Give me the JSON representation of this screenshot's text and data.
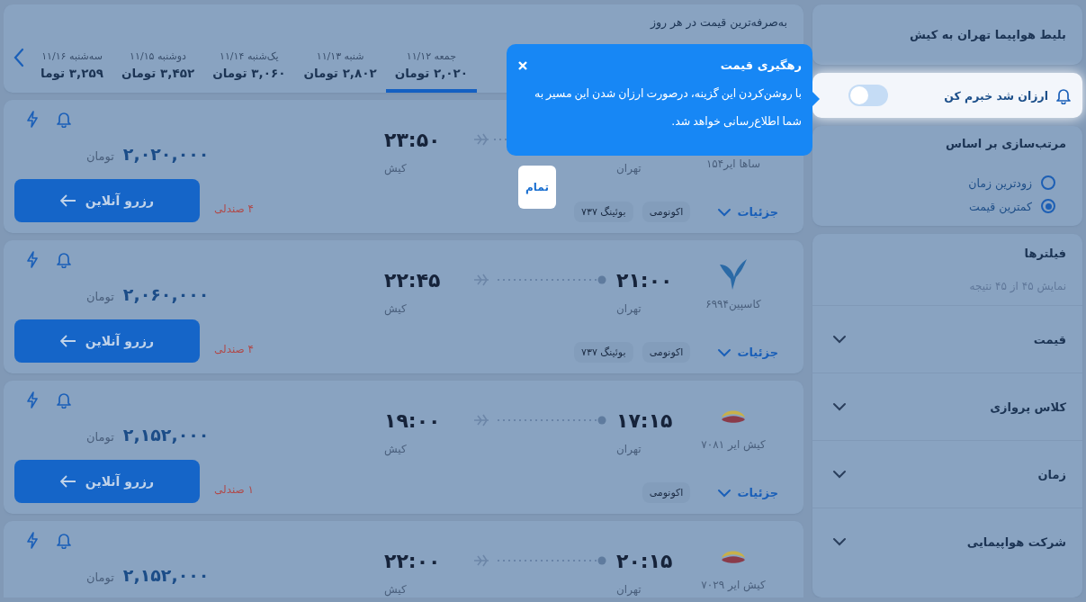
{
  "sidebar": {
    "route_title": "بلیط هواپیما تهران به کیش",
    "price_alert": {
      "label": "ارزان شد خبرم کن",
      "on": false
    },
    "sort": {
      "title": "مرتب‌سازی بر اساس",
      "options": [
        {
          "label": "زودترین زمان",
          "selected": false
        },
        {
          "label": "کمترین قیمت",
          "selected": true
        }
      ]
    },
    "filters": {
      "title": "فیلترها",
      "result_count": "نمایش ۴۵ از ۴۵ نتیجه",
      "groups": [
        {
          "label": "قیمت",
          "expanded": false
        },
        {
          "label": "کلاس پروازی",
          "expanded": false
        },
        {
          "label": "زمان",
          "expanded": false
        },
        {
          "label": "شرکت هواپیمایی",
          "expanded": false
        }
      ]
    }
  },
  "date_bar": {
    "title": "به‌صرفه‌ترین قیمت در هر روز",
    "days": [
      {
        "date": "جمعه ۱۱/۱۲",
        "price": "۲,۰۲۰ تومان",
        "selected": true
      },
      {
        "date": "شنبه ۱۱/۱۳",
        "price": "۲,۸۰۲ تومان",
        "selected": false
      },
      {
        "date": "یک‌شنبه ۱۱/۱۴",
        "price": "۳,۰۶۰ تومان",
        "selected": false
      },
      {
        "date": "دوشنبه ۱۱/۱۵",
        "price": "۳,۴۵۲ تومان",
        "selected": false
      },
      {
        "date": "سه‌شنبه ۱۱/۱۶",
        "price": "۳,۲۵۹ توما",
        "selected": false
      }
    ]
  },
  "flights": [
    {
      "airline": "ساها ایر۱۵۴",
      "origin": "تهران",
      "arrival_time": "۲۳:۵۰",
      "destination": "کیش",
      "price": "۲,۰۲۰,۰۰۰",
      "currency": "تومان",
      "book": "رزرو آنلاین",
      "seats": "۴ صندلی",
      "details": "جزئیات",
      "tags": [
        "اکونومی",
        "بوئینگ ۷۳۷"
      ]
    },
    {
      "kind": "bird",
      "airline": "کاسپین۶۹۹۴",
      "departure_time": "۲۱:۰۰",
      "origin": "تهران",
      "arrival_time": "۲۲:۴۵",
      "destination": "کیش",
      "price": "۲,۰۶۰,۰۰۰",
      "currency": "تومان",
      "book": "رزرو آنلاین",
      "seats": "۴ صندلی",
      "details": "جزئیات",
      "tags": [
        "اکونومی",
        "بوئینگ ۷۳۷"
      ]
    },
    {
      "kind": "kish",
      "airline": "کیش ایر ۷۰۸۱",
      "departure_time": "۱۷:۱۵",
      "origin": "تهران",
      "arrival_time": "۱۹:۰۰",
      "destination": "کیش",
      "price": "۲,۱۵۲,۰۰۰",
      "currency": "تومان",
      "book": "رزرو آنلاین",
      "seats": "۱ صندلی",
      "details": "جزئیات",
      "tags": [
        "اکونومی"
      ]
    },
    {
      "kind": "kish",
      "airline": "کیش ایر ۷۰۲۹",
      "departure_time": "۲۰:۱۵",
      "origin": "تهران",
      "arrival_time": "۲۲:۰۰",
      "destination": "کیش",
      "price": "۲,۱۵۲,۰۰۰",
      "currency": "تومان"
    }
  ],
  "tooltip": {
    "title": "رهگیری قیمت",
    "body": "با روشن‌کردن این گزینه، درصورت ارزان شدن این مسیر به شما اطلاع‌رسانی خواهد شد.",
    "done": "تمام"
  }
}
